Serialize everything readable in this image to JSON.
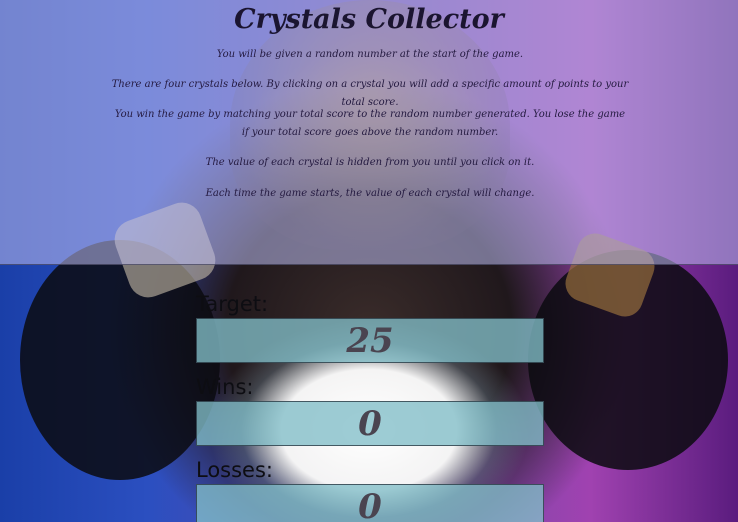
{
  "title": "Crystals Collector",
  "instructions": [
    "You will be given a random number at the start of the game.",
    "There are four crystals below. By clicking on a crystal you will add a specific amount of points to your total score.",
    "You win the game by matching your total score to the random number generated. You lose the game if your total score goes above the random number.",
    "The value of each crystal is hidden from you until you click on it.",
    "Each time the game starts, the value of each crystal will change."
  ],
  "target": {
    "label": "Target:",
    "value": "25"
  },
  "wins": {
    "label": "Wins:",
    "value": "0"
  },
  "losses": {
    "label": "Losses:",
    "value": "0"
  }
}
